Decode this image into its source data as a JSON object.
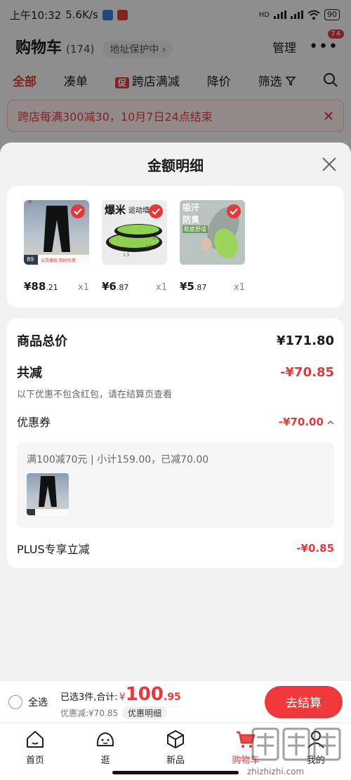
{
  "status_bar": {
    "time": "上午10:32",
    "speed": "5.6K/s",
    "battery": "90",
    "network": "HD"
  },
  "cart_header": {
    "title": "购物车",
    "count": "(174)",
    "address_protect": "地址保护中",
    "manage": "管理",
    "more_badge": "74"
  },
  "filter_tabs": {
    "items": [
      "全部",
      "凑单",
      "跨店满减",
      "降价",
      "筛选"
    ],
    "promo_tag": "促"
  },
  "promo_banner": {
    "text": "跨店每满300减30，10月7日24点结束"
  },
  "sheet": {
    "title": "金额明细",
    "products": [
      {
        "price_int": "¥88",
        "price_dec": ".21",
        "qty": "x1",
        "img_label": "尖货爆款 限时优惠",
        "img_num": "89"
      },
      {
        "price_int": "¥6",
        "price_dec": ".87",
        "qty": "x1",
        "img_label_1": "爆米",
        "img_label_2": "运动增高"
      },
      {
        "price_int": "¥5",
        "price_dec": ".87",
        "qty": "x1",
        "img_label_1": "吸汗",
        "img_label_2": "防臭",
        "img_label_3": "软底舒适"
      }
    ],
    "total_label": "商品总价",
    "total_value": "¥171.80",
    "reduce_label": "共减",
    "reduce_value": "-¥70.85",
    "reduce_note": "以下优惠不包含红包，请在结算页查看",
    "coupon_label": "优惠券",
    "coupon_value": "-¥70.00",
    "coupon_desc": "满100减70元 | 小计159.00，已减70.00",
    "plus_label": "PLUS专享立减",
    "plus_value": "-¥0.85"
  },
  "checkout": {
    "select_all": "全选",
    "selected_text": "已选3件,合计:",
    "currency": "¥",
    "amount_int": "100",
    "amount_dec": ".95",
    "discount_text": "优惠减:¥70.85",
    "detail_pill": "优惠明细",
    "button": "去结算"
  },
  "bottom_nav": {
    "items": [
      {
        "label": "首页",
        "icon": "home-icon"
      },
      {
        "label": "逛",
        "icon": "face-icon"
      },
      {
        "label": "新品",
        "icon": "cube-icon"
      },
      {
        "label": "购物车",
        "icon": "cart-icon"
      },
      {
        "label": "我的",
        "icon": "person-icon"
      }
    ]
  },
  "watermark": "zhizhizhi.com",
  "colors": {
    "accent": "#e4393c",
    "checkout_button": "#f0383b"
  }
}
